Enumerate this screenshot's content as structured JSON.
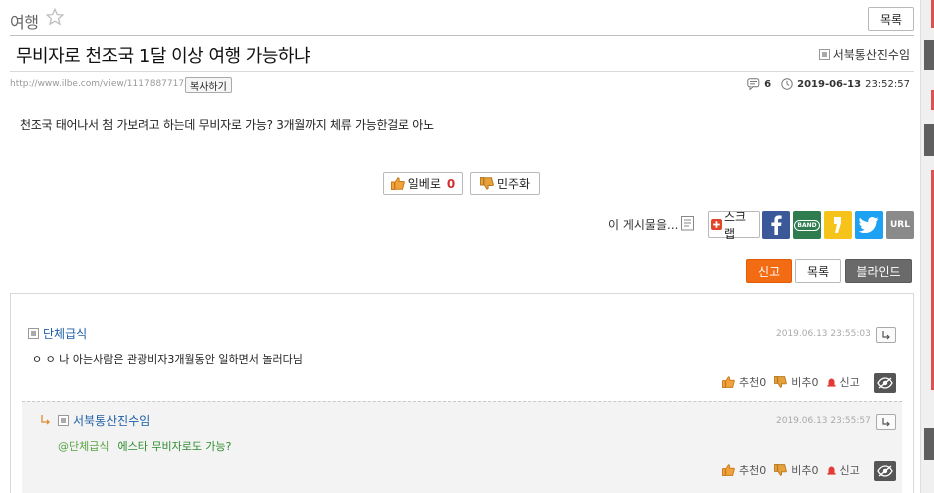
{
  "board": {
    "title": "여행",
    "list_label": "목록"
  },
  "post": {
    "title": "무비자로 천조국 1달 이상 여행 가능하냐",
    "author": "서북통산진수임",
    "url": "http://www.ilbe.com/view/11178877175",
    "copy_label": "복사하기",
    "comment_count": "6",
    "date": "2019-06-13",
    "time": "23:52:57",
    "body": "천조국 태어나서 첨 가보려고 하는데 무비자로 가능? 3개월까지 체류 가능한걸로 아노"
  },
  "votes": {
    "up_label": "일베로",
    "up_count": "0",
    "down_label": "민주화"
  },
  "share": {
    "label": "이 게시물을...",
    "scrap_label": "스크랩",
    "band_label": "BAND",
    "url_label": "URL"
  },
  "actions": {
    "report": "신고",
    "list": "목록",
    "blind": "블라인드"
  },
  "comments": [
    {
      "author": "단체급식",
      "time": "2019.06.13 23:55:03",
      "text": "ㅇ ㅇ 나 아는사람은 관광비자3개월동안 일하면서 놀러다님",
      "recommend": "추천0",
      "oppose": "비추0",
      "report": "신고"
    },
    {
      "author": "서북통산진수임",
      "time": "2019.06.13 23:55:57",
      "mention": "@단체급식",
      "text": "에스타 무비자로도 가능?",
      "recommend": "추천0",
      "oppose": "비추0",
      "report": "신고"
    }
  ],
  "colors": {
    "accent": "#f36b12",
    "author_link": "#1f5fa6",
    "mention": "#58a340",
    "up_count": "#d32f2f"
  }
}
